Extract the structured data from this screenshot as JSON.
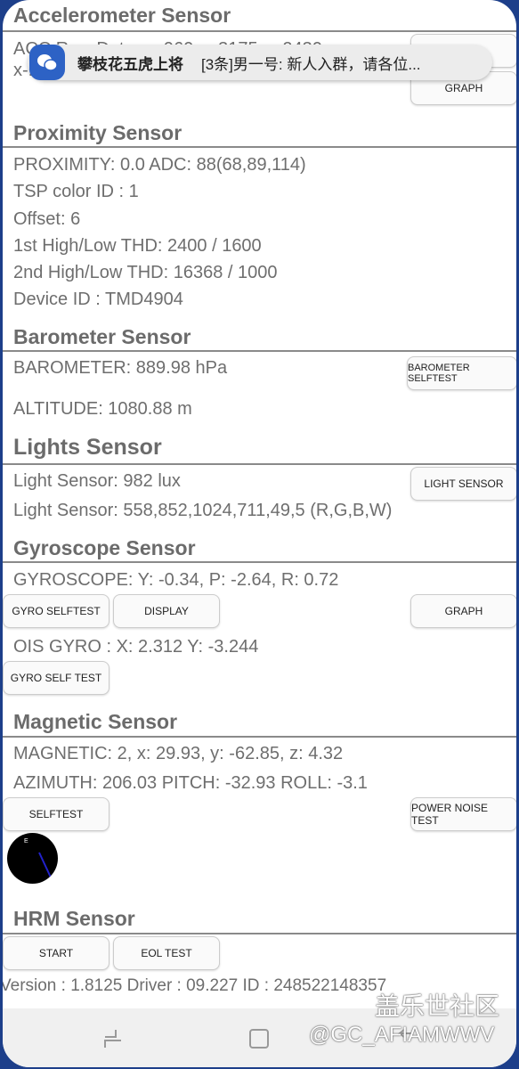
{
  "accelerometer": {
    "title": "Accelerometer Sensor",
    "line1": "ACC Raw Data: ... 960 ... 3175 ... 2430",
    "line2": "x-...",
    "btn_top": "...T",
    "btn_graph": "GRAPH"
  },
  "notification": {
    "app_icon": "wechat-icon",
    "sender": "攀枝花五虎上将",
    "message": "[3条]男一号: 新人入群，请各位..."
  },
  "proximity": {
    "title": "Proximity Sensor",
    "lines": [
      "PROXIMITY: 0.0      ADC: 88(68,89,114)",
      "TSP color ID : 1",
      "Offset: 6",
      "1st High/Low THD: 2400 / 1600",
      "2nd High/Low THD: 16368 / 1000",
      "Device ID : TMD4904"
    ]
  },
  "barometer": {
    "title": "Barometer Sensor",
    "value": "BAROMETER: 889.98 hPa",
    "altitude": "ALTITUDE: 1080.88 m",
    "selftest": "BAROMETER SELFTEST"
  },
  "lights": {
    "title": "Lights Sensor",
    "lux": "Light Sensor: 982 lux",
    "rgbw": "Light Sensor: 558,852,1024,711,49,5 (R,G,B,W)",
    "button": "LIGHT SENSOR"
  },
  "gyroscope": {
    "title": "Gyroscope Sensor",
    "value": "GYROSCOPE: Y: -0.34, P: -2.64, R: 0.72",
    "selftest": "GYRO SELFTEST",
    "display": "DISPLAY",
    "graph": "GRAPH",
    "ois": "OIS GYRO : X: 2.312 Y: -3.244",
    "ois_selftest": "GYRO SELF TEST"
  },
  "magnetic": {
    "title": "Magnetic Sensor",
    "value": "MAGNETIC: 2, x: 29.93, y: -62.85, z: 4.32",
    "orientation": "AZIMUTH: 206.03   PITCH: -32.93   ROLL: -3.1",
    "selftest": "SELFTEST",
    "power_noise": "POWER NOISE TEST",
    "compass_label": "E"
  },
  "hrm": {
    "title": "HRM Sensor",
    "start": "START",
    "eol": "EOL TEST",
    "info": "Version : 1.8125   Driver : 09.227   ID : 248522148357"
  },
  "watermark": {
    "line1": "盖乐世社区",
    "line2": "@GC_AFIAMWWV"
  }
}
